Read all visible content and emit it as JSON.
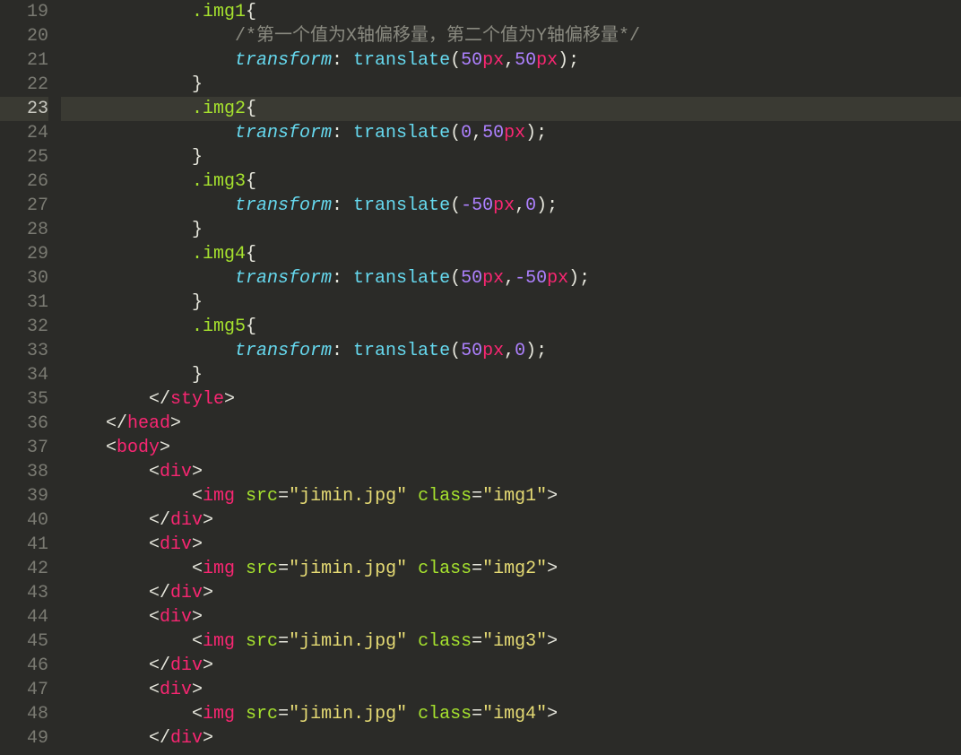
{
  "editor": {
    "activeLine": 23,
    "lines": [
      {
        "n": 19,
        "indent": 3,
        "type": "css-sel-open",
        "sel": ".img1"
      },
      {
        "n": 20,
        "indent": 4,
        "type": "comment",
        "text": "/*第一个值为X轴偏移量，第二个值为Y轴偏移量*/"
      },
      {
        "n": 21,
        "indent": 4,
        "type": "css-decl",
        "prop": "transform",
        "func": "translate",
        "args": [
          {
            "num": "50",
            "unit": "px"
          },
          {
            "num": "50",
            "unit": "px"
          }
        ]
      },
      {
        "n": 22,
        "indent": 3,
        "type": "brace-close"
      },
      {
        "n": 23,
        "indent": 3,
        "type": "css-sel-open",
        "sel": ".img2",
        "cursor": true
      },
      {
        "n": 24,
        "indent": 4,
        "type": "css-decl",
        "prop": "transform",
        "func": "translate",
        "args": [
          {
            "num": "0",
            "unit": ""
          },
          {
            "num": "50",
            "unit": "px"
          }
        ]
      },
      {
        "n": 25,
        "indent": 3,
        "type": "brace-close"
      },
      {
        "n": 26,
        "indent": 3,
        "type": "css-sel-open",
        "sel": ".img3"
      },
      {
        "n": 27,
        "indent": 4,
        "type": "css-decl",
        "prop": "transform",
        "func": "translate",
        "args": [
          {
            "num": "-50",
            "unit": "px"
          },
          {
            "num": "0",
            "unit": ""
          }
        ]
      },
      {
        "n": 28,
        "indent": 3,
        "type": "brace-close"
      },
      {
        "n": 29,
        "indent": 3,
        "type": "css-sel-open",
        "sel": ".img4"
      },
      {
        "n": 30,
        "indent": 4,
        "type": "css-decl",
        "prop": "transform",
        "func": "translate",
        "args": [
          {
            "num": "50",
            "unit": "px"
          },
          {
            "num": "-50",
            "unit": "px"
          }
        ]
      },
      {
        "n": 31,
        "indent": 3,
        "type": "brace-close"
      },
      {
        "n": 32,
        "indent": 3,
        "type": "css-sel-open",
        "sel": ".img5"
      },
      {
        "n": 33,
        "indent": 4,
        "type": "css-decl",
        "prop": "transform",
        "func": "translate",
        "args": [
          {
            "num": "50",
            "unit": "px"
          },
          {
            "num": "0",
            "unit": ""
          }
        ]
      },
      {
        "n": 34,
        "indent": 3,
        "type": "brace-close"
      },
      {
        "n": 35,
        "indent": 2,
        "type": "html-close",
        "tag": "style"
      },
      {
        "n": 36,
        "indent": 1,
        "type": "html-close",
        "tag": "head"
      },
      {
        "n": 37,
        "indent": 1,
        "type": "html-open",
        "tag": "body"
      },
      {
        "n": 38,
        "indent": 2,
        "type": "html-open",
        "tag": "div"
      },
      {
        "n": 39,
        "indent": 3,
        "type": "html-img",
        "src": "jimin.jpg",
        "cls": "img1"
      },
      {
        "n": 40,
        "indent": 2,
        "type": "html-close",
        "tag": "div"
      },
      {
        "n": 41,
        "indent": 2,
        "type": "html-open",
        "tag": "div"
      },
      {
        "n": 42,
        "indent": 3,
        "type": "html-img",
        "src": "jimin.jpg",
        "cls": "img2"
      },
      {
        "n": 43,
        "indent": 2,
        "type": "html-close",
        "tag": "div"
      },
      {
        "n": 44,
        "indent": 2,
        "type": "html-open",
        "tag": "div"
      },
      {
        "n": 45,
        "indent": 3,
        "type": "html-img",
        "src": "jimin.jpg",
        "cls": "img3"
      },
      {
        "n": 46,
        "indent": 2,
        "type": "html-close",
        "tag": "div"
      },
      {
        "n": 47,
        "indent": 2,
        "type": "html-open",
        "tag": "div"
      },
      {
        "n": 48,
        "indent": 3,
        "type": "html-img",
        "src": "jimin.jpg",
        "cls": "img4"
      },
      {
        "n": 49,
        "indent": 2,
        "type": "html-close",
        "tag": "div"
      }
    ]
  }
}
